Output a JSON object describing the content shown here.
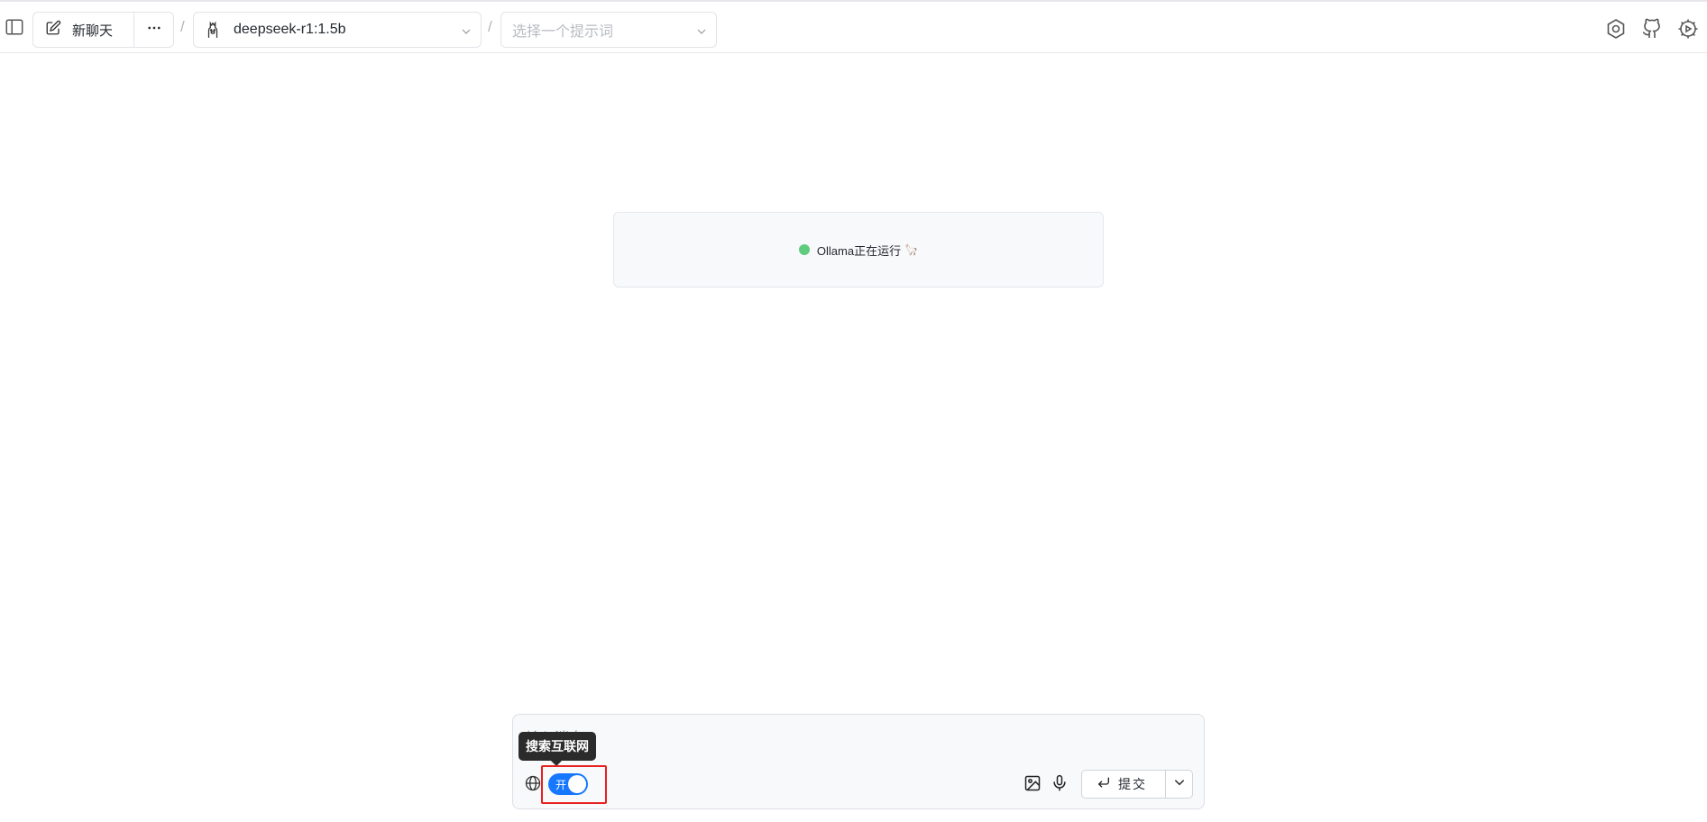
{
  "header": {
    "new_chat_label": "新聊天",
    "model_value": "deepseek-r1:1.5b",
    "prompt_placeholder": "选择一个提示词",
    "separator": "/"
  },
  "status": {
    "text": "Ollama正在运行",
    "emoji": "🦙",
    "dot_color": "#5fcc7d"
  },
  "composer": {
    "input_placeholder": "输入消息...",
    "input_value": "",
    "search_toggle_label": "开",
    "search_toggle_on": true,
    "tooltip": "搜索互联网",
    "submit_label": "提交"
  },
  "icons": {
    "sidebar": "sidebar-toggle-icon",
    "edit": "edit-icon",
    "more": "more-icon",
    "llama": "llama-icon",
    "settings": "settings-icon",
    "github": "github-icon",
    "system": "system-settings-icon",
    "globe": "globe-icon",
    "image": "image-icon",
    "mic": "microphone-icon",
    "enter": "enter-icon",
    "chevron": "chevron-down-icon"
  },
  "colors": {
    "accent": "#1677ff",
    "highlight": "#e8201f",
    "tooltip_bg": "#2b2b2b"
  }
}
